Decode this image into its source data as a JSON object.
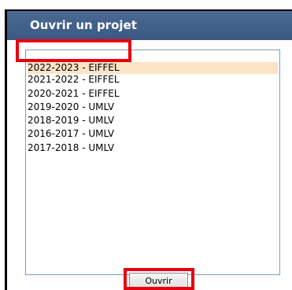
{
  "dialog": {
    "title": "Ouvrir un projet"
  },
  "projects": {
    "selected_index": 0,
    "items": [
      "2022-2023 - EIFFEL",
      "2021-2022 - EIFFEL",
      "2020-2021 - EIFFEL",
      "2019-2020 - UMLV",
      "2018-2019 - UMLV",
      "2016-2017 - UMLV",
      "2017-2018 - UMLV"
    ]
  },
  "actions": {
    "open_label": "Ouvrir"
  },
  "colors": {
    "title_bar": "#3f5f8a",
    "selection": "#fbe3c6",
    "annotation_highlight": "#e8000e"
  }
}
